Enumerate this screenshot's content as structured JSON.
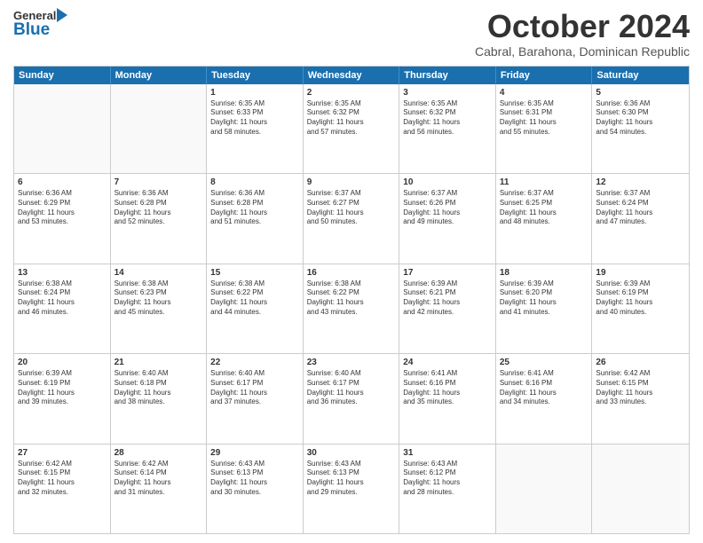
{
  "header": {
    "logo_general": "General",
    "logo_blue": "Blue",
    "month_title": "October 2024",
    "subtitle": "Cabral, Barahona, Dominican Republic"
  },
  "weekdays": [
    "Sunday",
    "Monday",
    "Tuesday",
    "Wednesday",
    "Thursday",
    "Friday",
    "Saturday"
  ],
  "rows": [
    [
      {
        "day": "",
        "lines": []
      },
      {
        "day": "",
        "lines": []
      },
      {
        "day": "1",
        "lines": [
          "Sunrise: 6:35 AM",
          "Sunset: 6:33 PM",
          "Daylight: 11 hours",
          "and 58 minutes."
        ]
      },
      {
        "day": "2",
        "lines": [
          "Sunrise: 6:35 AM",
          "Sunset: 6:32 PM",
          "Daylight: 11 hours",
          "and 57 minutes."
        ]
      },
      {
        "day": "3",
        "lines": [
          "Sunrise: 6:35 AM",
          "Sunset: 6:32 PM",
          "Daylight: 11 hours",
          "and 56 minutes."
        ]
      },
      {
        "day": "4",
        "lines": [
          "Sunrise: 6:35 AM",
          "Sunset: 6:31 PM",
          "Daylight: 11 hours",
          "and 55 minutes."
        ]
      },
      {
        "day": "5",
        "lines": [
          "Sunrise: 6:36 AM",
          "Sunset: 6:30 PM",
          "Daylight: 11 hours",
          "and 54 minutes."
        ]
      }
    ],
    [
      {
        "day": "6",
        "lines": [
          "Sunrise: 6:36 AM",
          "Sunset: 6:29 PM",
          "Daylight: 11 hours",
          "and 53 minutes."
        ]
      },
      {
        "day": "7",
        "lines": [
          "Sunrise: 6:36 AM",
          "Sunset: 6:28 PM",
          "Daylight: 11 hours",
          "and 52 minutes."
        ]
      },
      {
        "day": "8",
        "lines": [
          "Sunrise: 6:36 AM",
          "Sunset: 6:28 PM",
          "Daylight: 11 hours",
          "and 51 minutes."
        ]
      },
      {
        "day": "9",
        "lines": [
          "Sunrise: 6:37 AM",
          "Sunset: 6:27 PM",
          "Daylight: 11 hours",
          "and 50 minutes."
        ]
      },
      {
        "day": "10",
        "lines": [
          "Sunrise: 6:37 AM",
          "Sunset: 6:26 PM",
          "Daylight: 11 hours",
          "and 49 minutes."
        ]
      },
      {
        "day": "11",
        "lines": [
          "Sunrise: 6:37 AM",
          "Sunset: 6:25 PM",
          "Daylight: 11 hours",
          "and 48 minutes."
        ]
      },
      {
        "day": "12",
        "lines": [
          "Sunrise: 6:37 AM",
          "Sunset: 6:24 PM",
          "Daylight: 11 hours",
          "and 47 minutes."
        ]
      }
    ],
    [
      {
        "day": "13",
        "lines": [
          "Sunrise: 6:38 AM",
          "Sunset: 6:24 PM",
          "Daylight: 11 hours",
          "and 46 minutes."
        ]
      },
      {
        "day": "14",
        "lines": [
          "Sunrise: 6:38 AM",
          "Sunset: 6:23 PM",
          "Daylight: 11 hours",
          "and 45 minutes."
        ]
      },
      {
        "day": "15",
        "lines": [
          "Sunrise: 6:38 AM",
          "Sunset: 6:22 PM",
          "Daylight: 11 hours",
          "and 44 minutes."
        ]
      },
      {
        "day": "16",
        "lines": [
          "Sunrise: 6:38 AM",
          "Sunset: 6:22 PM",
          "Daylight: 11 hours",
          "and 43 minutes."
        ]
      },
      {
        "day": "17",
        "lines": [
          "Sunrise: 6:39 AM",
          "Sunset: 6:21 PM",
          "Daylight: 11 hours",
          "and 42 minutes."
        ]
      },
      {
        "day": "18",
        "lines": [
          "Sunrise: 6:39 AM",
          "Sunset: 6:20 PM",
          "Daylight: 11 hours",
          "and 41 minutes."
        ]
      },
      {
        "day": "19",
        "lines": [
          "Sunrise: 6:39 AM",
          "Sunset: 6:19 PM",
          "Daylight: 11 hours",
          "and 40 minutes."
        ]
      }
    ],
    [
      {
        "day": "20",
        "lines": [
          "Sunrise: 6:39 AM",
          "Sunset: 6:19 PM",
          "Daylight: 11 hours",
          "and 39 minutes."
        ]
      },
      {
        "day": "21",
        "lines": [
          "Sunrise: 6:40 AM",
          "Sunset: 6:18 PM",
          "Daylight: 11 hours",
          "and 38 minutes."
        ]
      },
      {
        "day": "22",
        "lines": [
          "Sunrise: 6:40 AM",
          "Sunset: 6:17 PM",
          "Daylight: 11 hours",
          "and 37 minutes."
        ]
      },
      {
        "day": "23",
        "lines": [
          "Sunrise: 6:40 AM",
          "Sunset: 6:17 PM",
          "Daylight: 11 hours",
          "and 36 minutes."
        ]
      },
      {
        "day": "24",
        "lines": [
          "Sunrise: 6:41 AM",
          "Sunset: 6:16 PM",
          "Daylight: 11 hours",
          "and 35 minutes."
        ]
      },
      {
        "day": "25",
        "lines": [
          "Sunrise: 6:41 AM",
          "Sunset: 6:16 PM",
          "Daylight: 11 hours",
          "and 34 minutes."
        ]
      },
      {
        "day": "26",
        "lines": [
          "Sunrise: 6:42 AM",
          "Sunset: 6:15 PM",
          "Daylight: 11 hours",
          "and 33 minutes."
        ]
      }
    ],
    [
      {
        "day": "27",
        "lines": [
          "Sunrise: 6:42 AM",
          "Sunset: 6:15 PM",
          "Daylight: 11 hours",
          "and 32 minutes."
        ]
      },
      {
        "day": "28",
        "lines": [
          "Sunrise: 6:42 AM",
          "Sunset: 6:14 PM",
          "Daylight: 11 hours",
          "and 31 minutes."
        ]
      },
      {
        "day": "29",
        "lines": [
          "Sunrise: 6:43 AM",
          "Sunset: 6:13 PM",
          "Daylight: 11 hours",
          "and 30 minutes."
        ]
      },
      {
        "day": "30",
        "lines": [
          "Sunrise: 6:43 AM",
          "Sunset: 6:13 PM",
          "Daylight: 11 hours",
          "and 29 minutes."
        ]
      },
      {
        "day": "31",
        "lines": [
          "Sunrise: 6:43 AM",
          "Sunset: 6:12 PM",
          "Daylight: 11 hours",
          "and 28 minutes."
        ]
      },
      {
        "day": "",
        "lines": []
      },
      {
        "day": "",
        "lines": []
      }
    ]
  ]
}
